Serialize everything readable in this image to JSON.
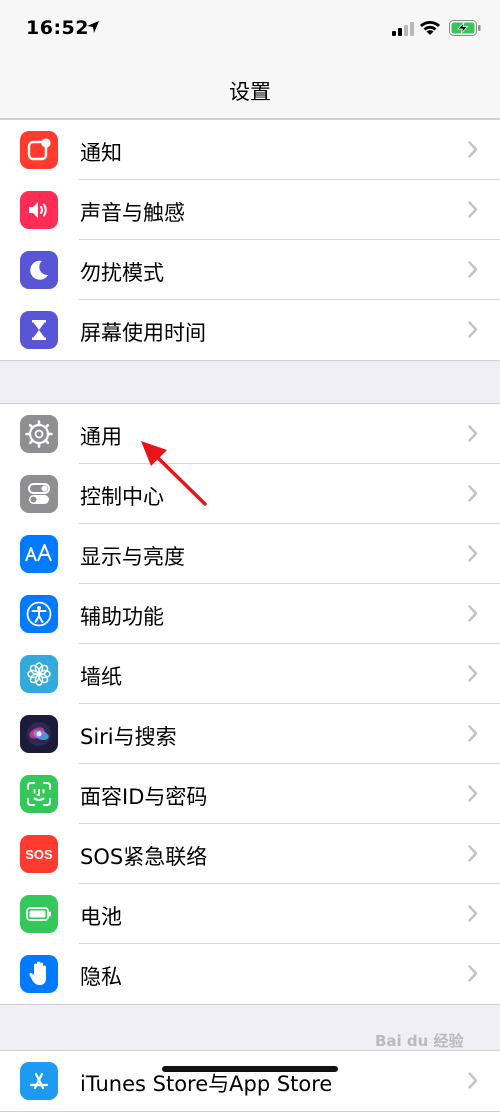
{
  "status": {
    "time": "16:52"
  },
  "nav": {
    "title": "设置"
  },
  "groups": [
    {
      "items": [
        {
          "label": "通知",
          "icon": "notifications-icon",
          "color": "#ff3b30"
        },
        {
          "label": "声音与触感",
          "icon": "speaker-icon",
          "color": "#ff2d55"
        },
        {
          "label": "勿扰模式",
          "icon": "moon-icon",
          "color": "#5856d6"
        },
        {
          "label": "屏幕使用时间",
          "icon": "hourglass-icon",
          "color": "#5856d6"
        }
      ]
    },
    {
      "items": [
        {
          "label": "通用",
          "icon": "gear-icon",
          "color": "#8e8e93"
        },
        {
          "label": "控制中心",
          "icon": "toggles-icon",
          "color": "#8e8e93"
        },
        {
          "label": "显示与亮度",
          "icon": "text-size-icon",
          "color": "#007aff"
        },
        {
          "label": "辅助功能",
          "icon": "accessibility-icon",
          "color": "#007aff"
        },
        {
          "label": "墙纸",
          "icon": "flower-icon",
          "color": "#34aadc"
        },
        {
          "label": "Siri与搜索",
          "icon": "siri-icon",
          "color": "#1c1c3a"
        },
        {
          "label": "面容ID与密码",
          "icon": "face-id-icon",
          "color": "#34c759"
        },
        {
          "label": "SOS紧急联络",
          "icon": "sos-icon",
          "color": "#ff3b30",
          "icon_text": "SOS"
        },
        {
          "label": "电池",
          "icon": "battery-icon",
          "color": "#34c759"
        },
        {
          "label": "隐私",
          "icon": "hand-icon",
          "color": "#007aff"
        }
      ]
    },
    {
      "items": [
        {
          "label": "iTunes Store与App Store",
          "icon": "app-store-icon",
          "color": "#1e9bf0"
        }
      ]
    }
  ],
  "watermark": "Bai du 经验"
}
